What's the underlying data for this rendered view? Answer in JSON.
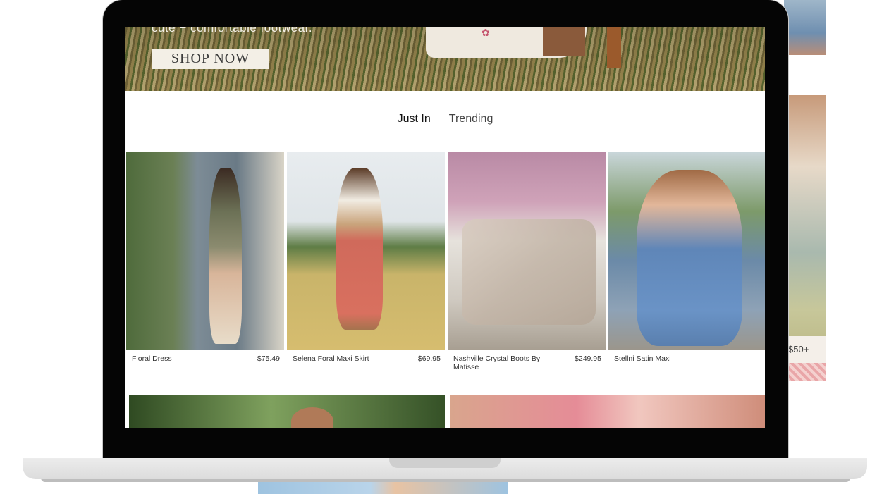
{
  "hero": {
    "tagline": "cute + comfortable footwear.",
    "cta_label": "SHOP NOW"
  },
  "tabs": [
    {
      "label": "Just In",
      "active": true
    },
    {
      "label": "Trending",
      "active": false
    }
  ],
  "products": [
    {
      "name": "Floral Dress",
      "price": "$75.49"
    },
    {
      "name": "Selena Foral Maxi Skirt",
      "price": "$69.95"
    },
    {
      "name": "Nashville Crystal Boots By Matisse",
      "price": "$249.95"
    },
    {
      "name": "Stellni Satin Maxi",
      "price": ""
    }
  ],
  "background": {
    "side_price": "$50+"
  },
  "colors": {
    "text": "#333333",
    "active_tab": "#111111",
    "cta_bg": "#f3efe6",
    "laptop_bezel": "#050505"
  }
}
